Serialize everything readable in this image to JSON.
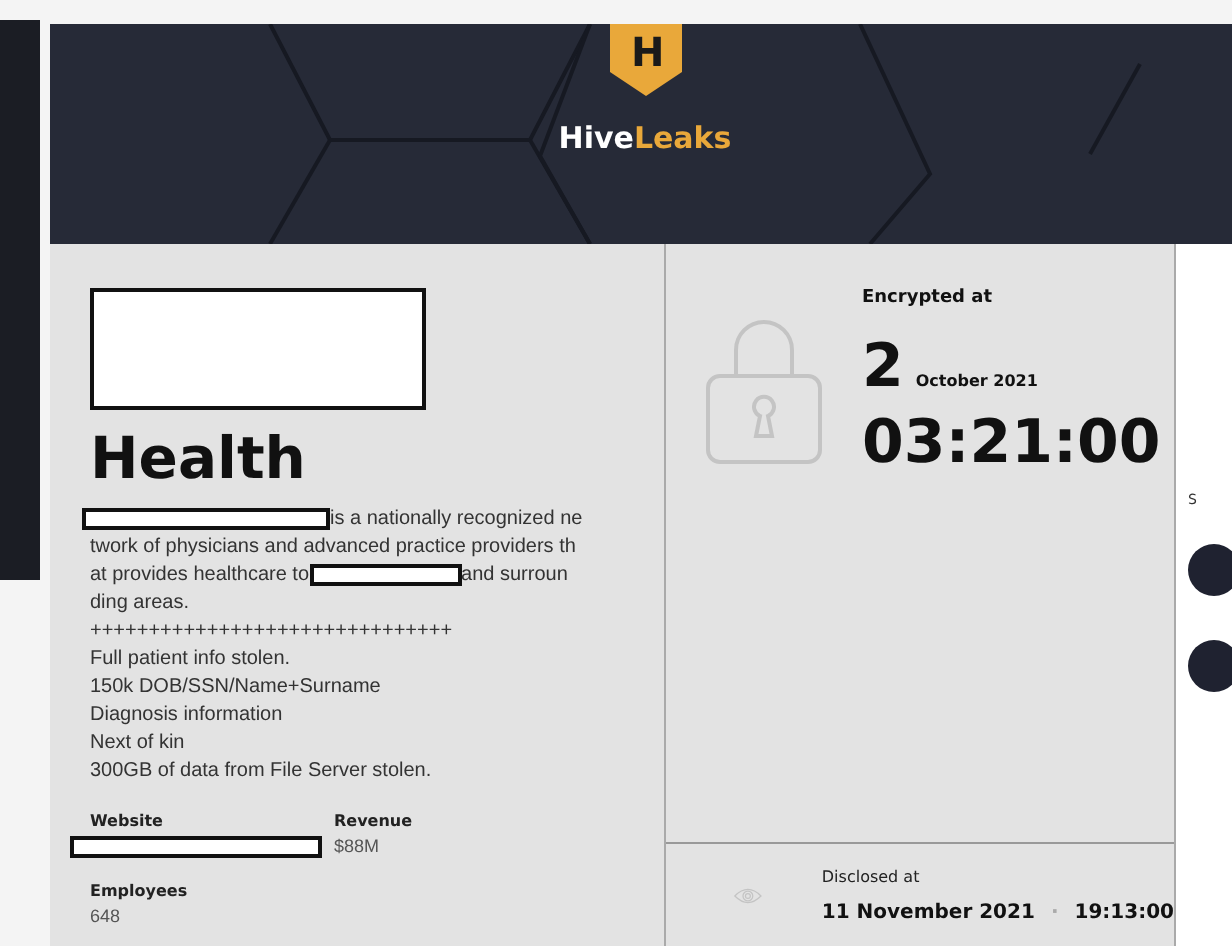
{
  "header": {
    "logo_letter": "H",
    "brand_first": "Hive",
    "brand_second": "Leaks"
  },
  "company": {
    "name": "Health",
    "description_lines": [
      {
        "segments": [
          {
            "kind": "redaction"
          },
          {
            "kind": "text",
            "text": "is a nationally recognized ne"
          }
        ]
      },
      {
        "segments": [
          {
            "kind": "text",
            "text": "twork of physicians and advanced practice providers th"
          }
        ]
      },
      {
        "segments": [
          {
            "kind": "text",
            "text": "at provides healthcare to"
          },
          {
            "kind": "redaction"
          },
          {
            "kind": "text",
            "text": "and surroun"
          }
        ]
      },
      {
        "segments": [
          {
            "kind": "text",
            "text": "ding areas."
          }
        ]
      },
      {
        "segments": [
          {
            "kind": "text",
            "text": "+++++++++++++++++++++++++++++++"
          }
        ]
      },
      {
        "segments": [
          {
            "kind": "text",
            "text": "Full patient info stolen."
          }
        ]
      },
      {
        "segments": [
          {
            "kind": "text",
            "text": "150k DOB/SSN/Name+Surname"
          }
        ]
      },
      {
        "segments": [
          {
            "kind": "text",
            "text": "Diagnosis information"
          }
        ]
      },
      {
        "segments": [
          {
            "kind": "text",
            "text": "Next of kin"
          }
        ]
      },
      {
        "segments": [
          {
            "kind": "text",
            "text": "300GB of data from File Server stolen."
          }
        ]
      }
    ],
    "website": {
      "label": "Website"
    },
    "revenue": {
      "label": "Revenue",
      "value": "$88M"
    },
    "employees": {
      "label": "Employees",
      "value": "648"
    }
  },
  "encrypted": {
    "label": "Encrypted at",
    "day": "2",
    "month_year": "October 2021",
    "time": "03:21:00"
  },
  "disclosed": {
    "label": "Disclosed at",
    "date": "11 November 2021",
    "separator": "·",
    "time": "19:13:00"
  },
  "right_panel": {
    "label_fragment": "S"
  }
}
